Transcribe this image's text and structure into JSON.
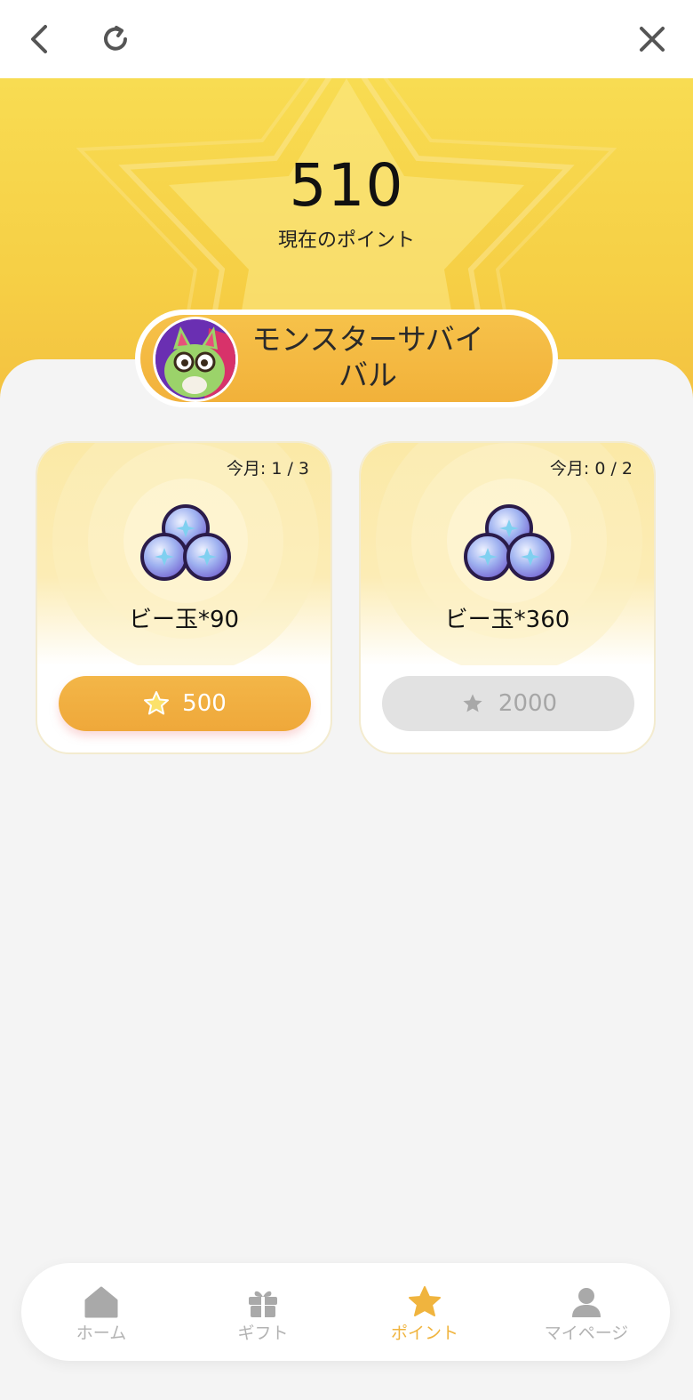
{
  "topbar": {
    "back_icon": "chevron-left-icon",
    "reload_icon": "reload-icon",
    "close_icon": "close-icon"
  },
  "points": {
    "value": "510",
    "label": "現在のポイント"
  },
  "game": {
    "title_line1": "モンスターサバイ",
    "title_line2": "バル"
  },
  "rewards": [
    {
      "limit": "今月: 1 / 3",
      "name": "ビー玉*90",
      "cost": "500",
      "state": "active"
    },
    {
      "limit": "今月: 0 / 2",
      "name": "ビー玉*360",
      "cost": "2000",
      "state": "disabled"
    }
  ],
  "tabs": [
    {
      "label": "ホーム",
      "icon": "home-icon",
      "active": false
    },
    {
      "label": "ギフト",
      "icon": "gift-icon",
      "active": false
    },
    {
      "label": "ポイント",
      "icon": "star-icon",
      "active": true
    },
    {
      "label": "マイページ",
      "icon": "user-icon",
      "active": false
    }
  ],
  "colors": {
    "accent": "#f0b43e",
    "hero_yellow": "#f6cf45",
    "disabled": "#e2e2e2"
  }
}
